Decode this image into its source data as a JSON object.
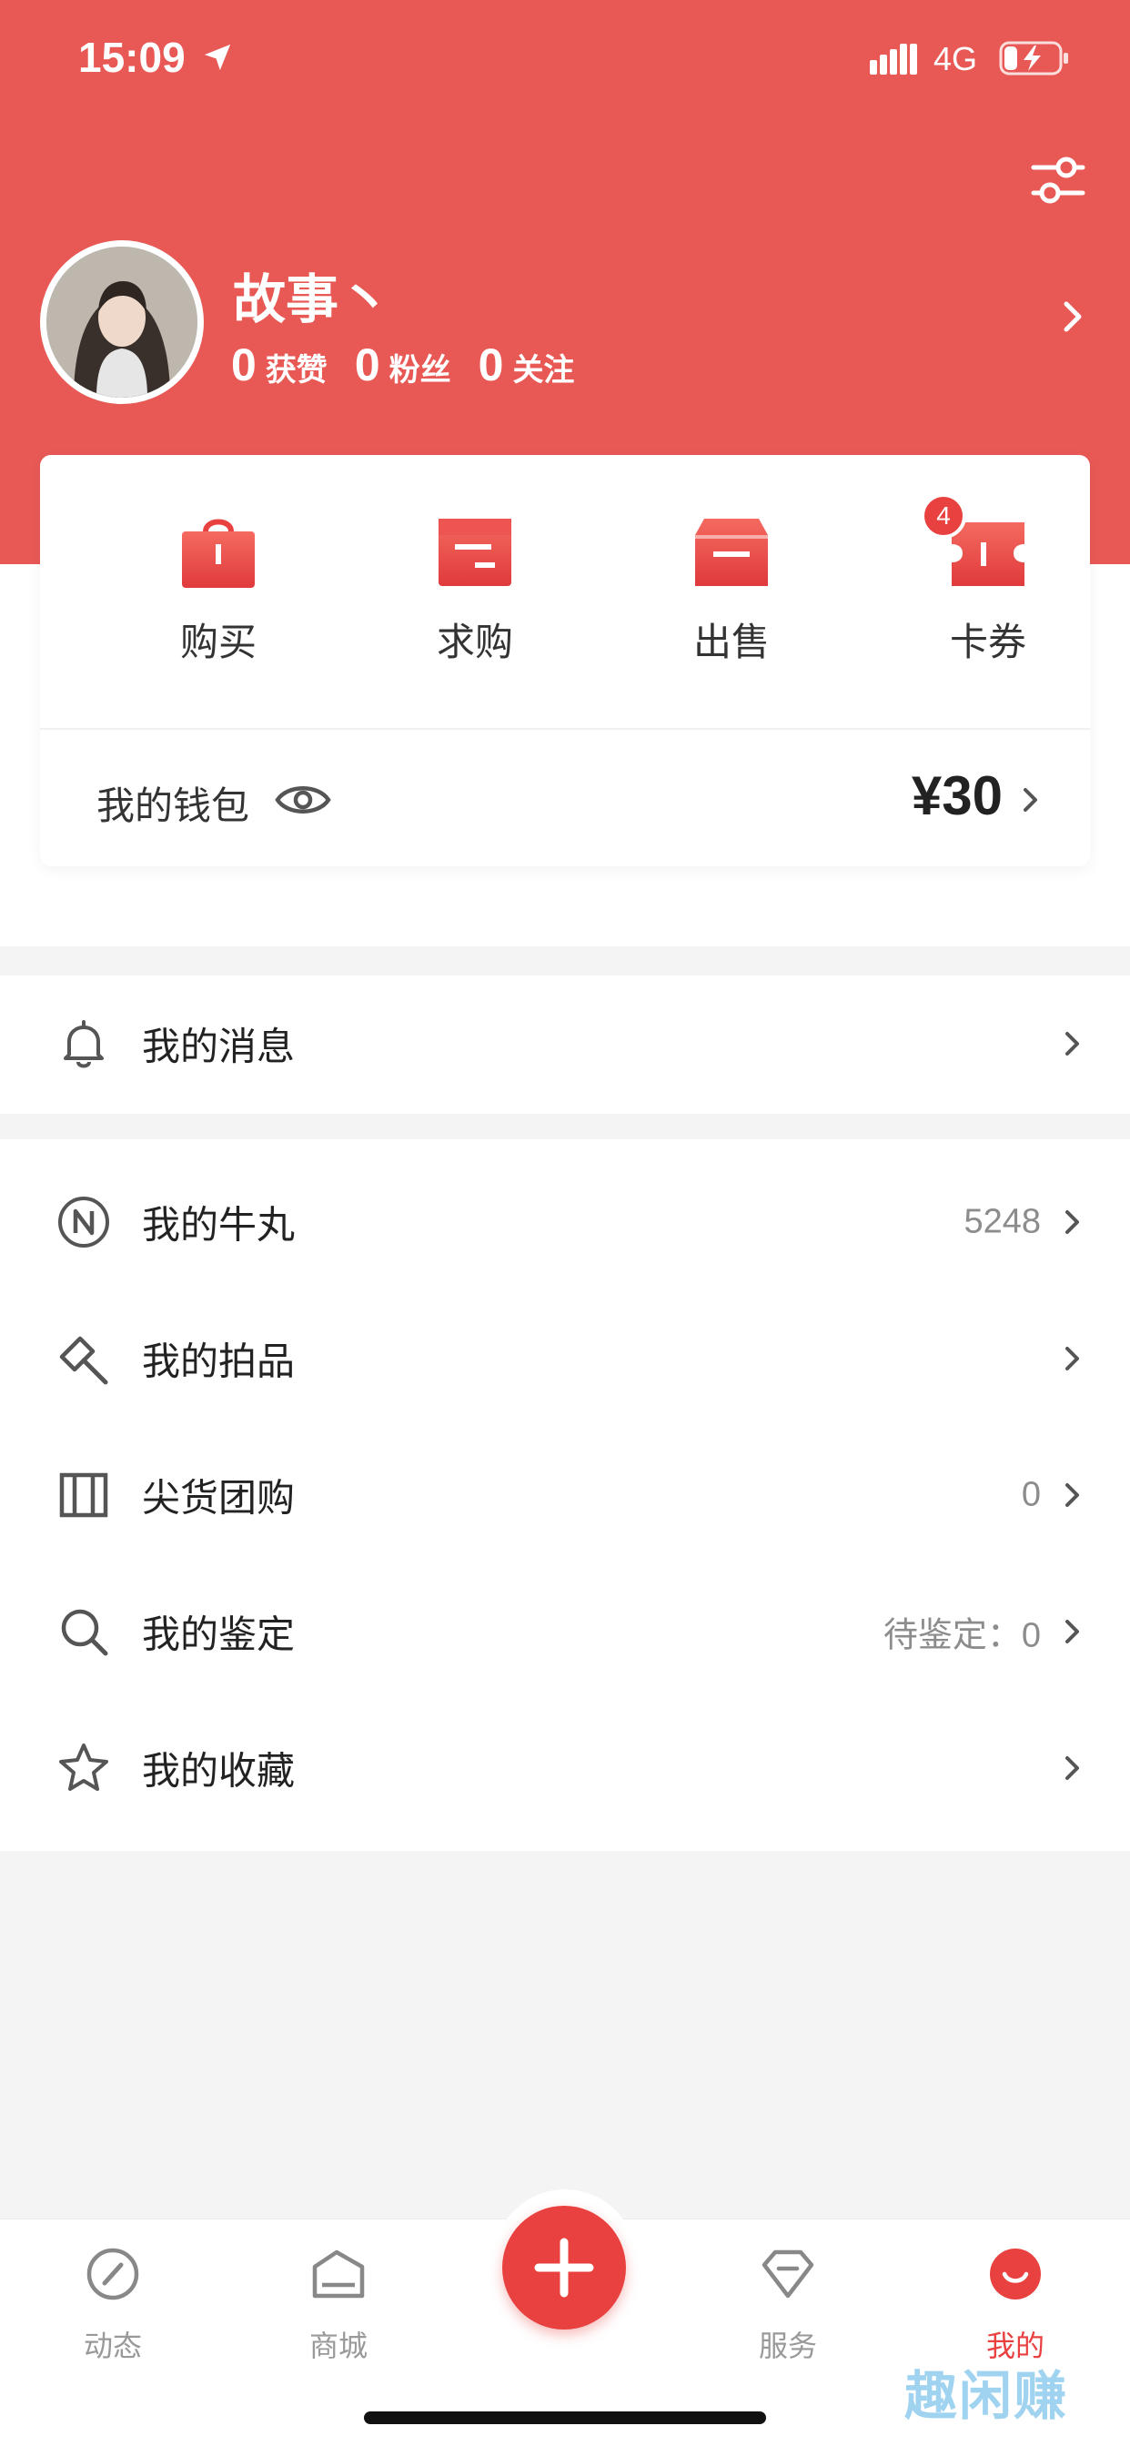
{
  "status_bar": {
    "time": "15:09",
    "network": "4G",
    "icons": [
      "location-arrow-icon",
      "signal-icon",
      "battery-charging-icon"
    ]
  },
  "header": {
    "settings_icon": "settings-sliders-icon"
  },
  "profile": {
    "username": "故事丶",
    "stats": [
      {
        "count": "0",
        "label": "获赞"
      },
      {
        "count": "0",
        "label": "粉丝"
      },
      {
        "count": "0",
        "label": "关注"
      }
    ]
  },
  "quick_actions": [
    {
      "label": "购买",
      "icon": "shopping-bag-icon"
    },
    {
      "label": "求购",
      "icon": "wallet-card-icon"
    },
    {
      "label": "出售",
      "icon": "box-icon"
    },
    {
      "label": "卡券",
      "icon": "ticket-icon",
      "badge": "4"
    }
  ],
  "wallet": {
    "label": "我的钱包",
    "amount": "¥30",
    "icon": "eye-icon"
  },
  "messages": {
    "label": "我的消息",
    "icon": "bell-icon"
  },
  "menu": [
    {
      "label": "我的牛丸",
      "value": "5248",
      "icon": "coin-n-icon"
    },
    {
      "label": "我的拍品",
      "value": "",
      "icon": "auction-hammer-icon"
    },
    {
      "label": "尖货团购",
      "value": "0",
      "icon": "ticket-stub-icon"
    },
    {
      "label": "我的鉴定",
      "value": "待鉴定：0",
      "icon": "search-icon"
    },
    {
      "label": "我的收藏",
      "value": "",
      "icon": "star-icon"
    }
  ],
  "tabbar": [
    {
      "label": "动态",
      "icon": "compass-icon",
      "active": false
    },
    {
      "label": "商城",
      "icon": "store-icon",
      "active": false
    },
    {
      "label": "",
      "icon": "plus-icon",
      "active": false
    },
    {
      "label": "服务",
      "icon": "diamond-icon",
      "active": false
    },
    {
      "label": "我的",
      "icon": "smile-face-icon",
      "active": true
    }
  ],
  "colors": {
    "brand_red": "#E85955",
    "accent_red": "#E8413F"
  },
  "watermark": "趣闲赚"
}
